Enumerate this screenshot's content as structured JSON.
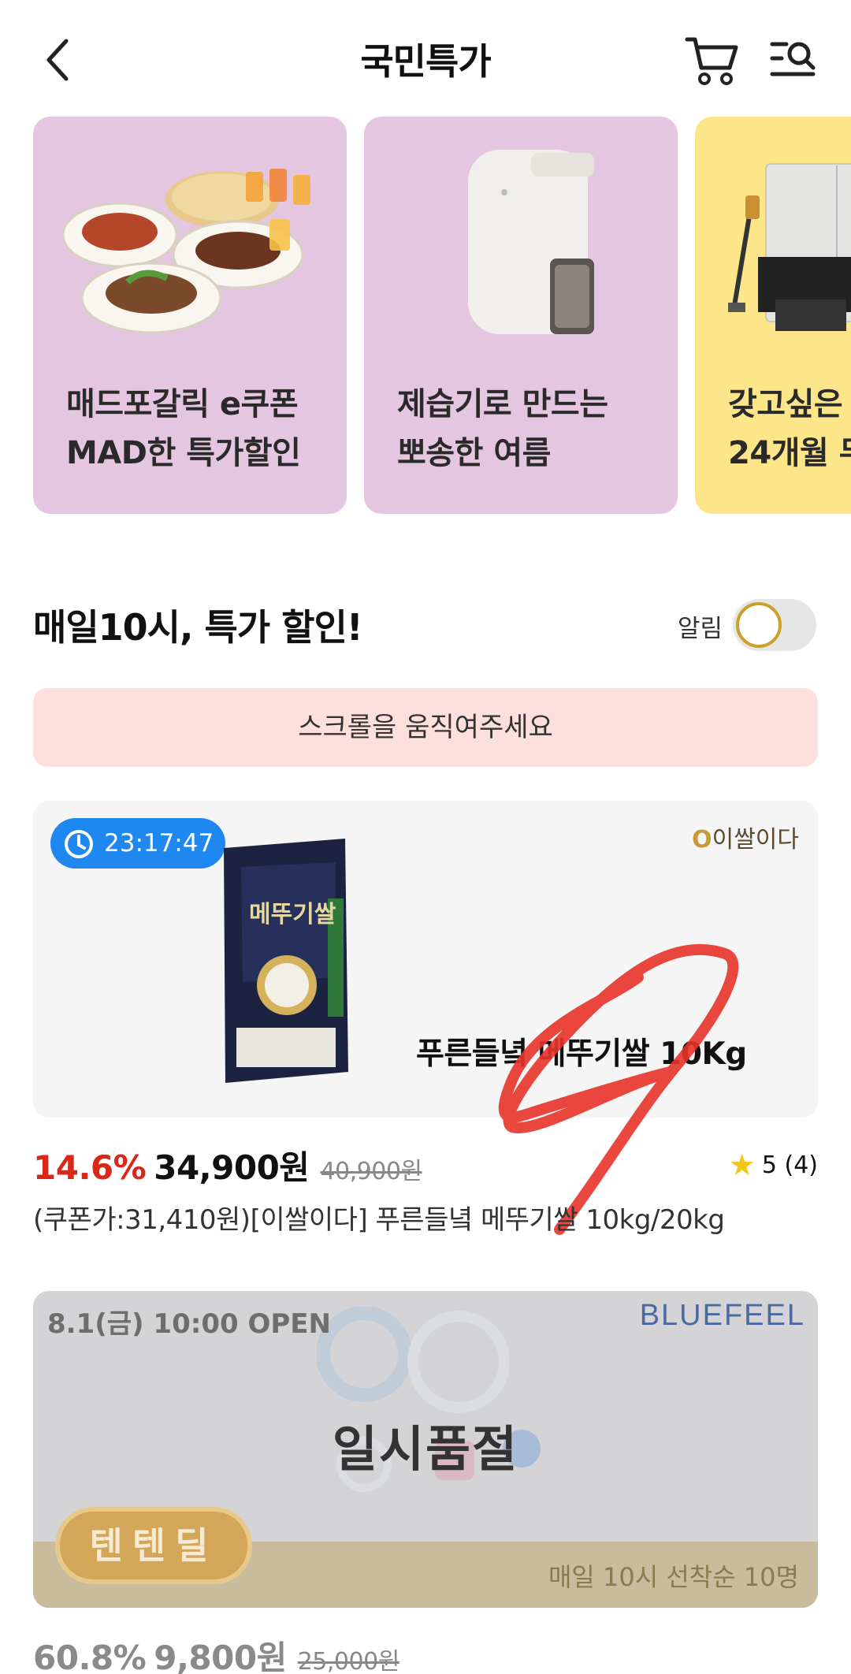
{
  "header": {
    "title": "국민특가"
  },
  "banners": [
    {
      "line1": "매드포갈릭 e쿠폰",
      "line2": "MAD한 특가할인",
      "bg": "#e5c6e0"
    },
    {
      "line1": "제습기로 만드는",
      "line2": "뽀송한 여름",
      "bg": "#e5c6e0"
    },
    {
      "line1": "갖고싶은",
      "line2": "24개월 무",
      "bg": "#fde58a"
    }
  ],
  "section": {
    "title": "매일10시, 특가 할인!",
    "alarm_label": "알림",
    "alarm_on": false,
    "scroll_hint": "스크롤을 움직여주세요"
  },
  "products": [
    {
      "timer": "23:17:47",
      "brand": "이쌀이다",
      "image_title": "푸른들녘 메뚜기쌀 10Kg",
      "discount": "14.6%",
      "price": "34,900원",
      "original_price": "40,900원",
      "rating": "5",
      "review_count": "(4)",
      "description": "(쿠폰가:31,410원)[이쌀이다] 푸른들녘 메뚜기쌀 10kg/20kg"
    },
    {
      "open_text": "8.1(금) 10:00 OPEN",
      "brand": "BLUEFEEL",
      "status": "일시품절",
      "badge": "텐텐딜",
      "notice": "매일 10시 선착순 10명",
      "discount": "60.8%",
      "price": "9,800원",
      "original_price": "25,000원"
    }
  ],
  "colors": {
    "accent_red": "#d9281a",
    "timer_blue": "#1e87f0",
    "hint_bg": "#fde0dc"
  }
}
